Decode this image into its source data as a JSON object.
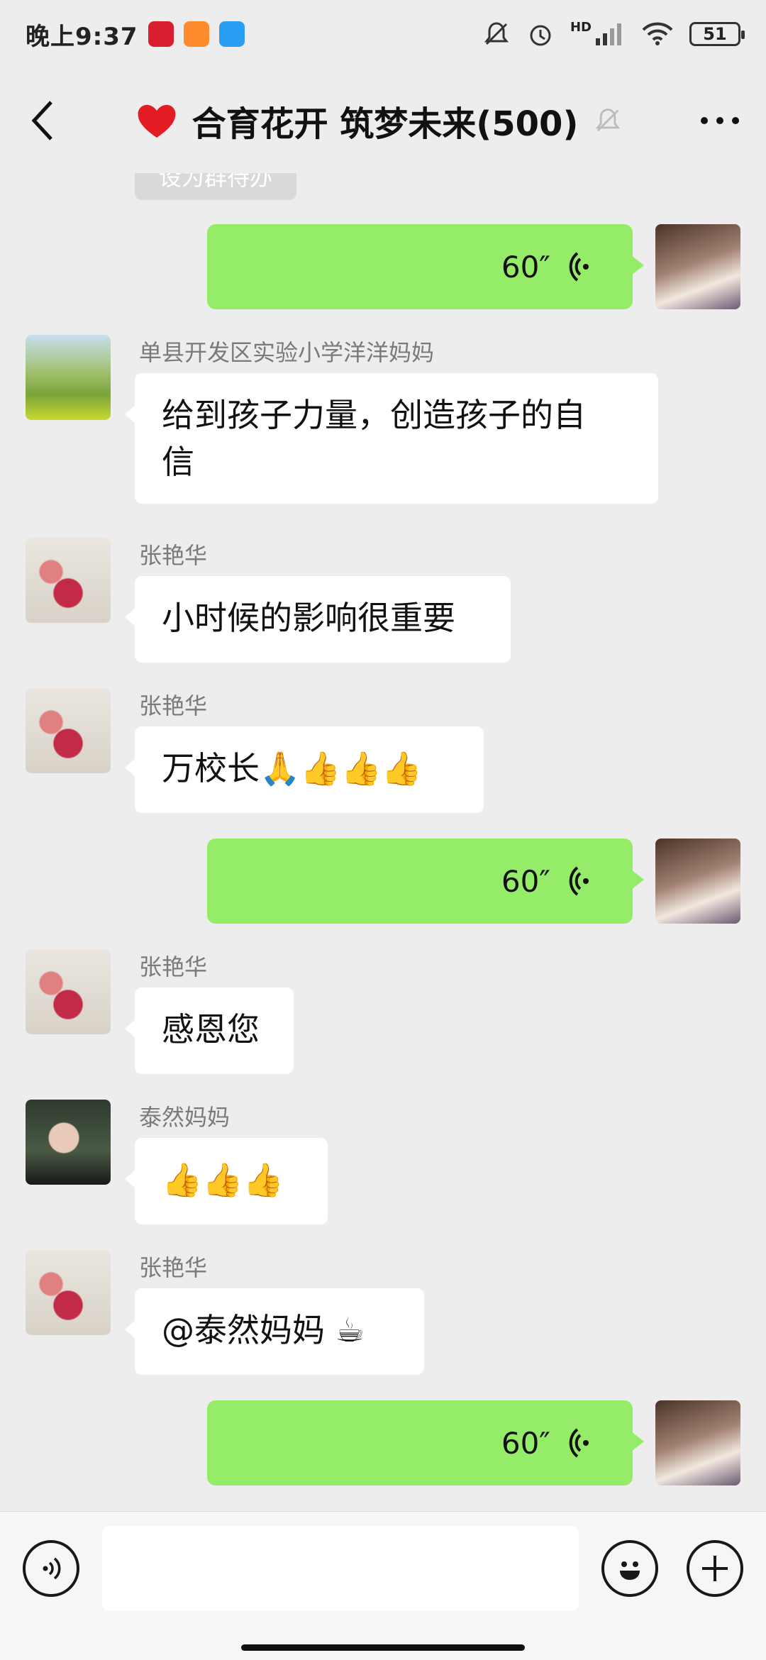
{
  "status": {
    "time": "晚上9:37",
    "battery": "51",
    "network": "HD"
  },
  "header": {
    "title": "合育花开 筑梦未来(500)",
    "emoji": "heart-emoji"
  },
  "system_tag": "设为群待办",
  "messages": [
    {
      "type": "voice",
      "side": "right",
      "duration": "60″"
    },
    {
      "type": "text",
      "side": "left",
      "sender": "单县开发区实验小学洋洋妈妈",
      "lines": [
        "给到孩子力量，创造孩子的自",
        "信"
      ]
    },
    {
      "type": "text",
      "side": "left",
      "sender": "张艳华",
      "text": "小时候的影响很重要"
    },
    {
      "type": "text",
      "side": "left",
      "sender": "张艳华",
      "text": "万校长",
      "emojis": [
        "🙏",
        "👍",
        "👍",
        "👍"
      ]
    },
    {
      "type": "voice",
      "side": "right",
      "duration": "60″"
    },
    {
      "type": "text",
      "side": "left",
      "sender": "张艳华",
      "text": "感恩您"
    },
    {
      "type": "text",
      "side": "left",
      "sender": "泰然妈妈",
      "emojis": [
        "👍",
        "👍",
        "👍"
      ]
    },
    {
      "type": "text",
      "side": "left",
      "sender": "张艳华",
      "text": "@泰然妈妈",
      "emojis": [
        "☕"
      ]
    },
    {
      "type": "voice",
      "side": "right",
      "duration": "60″"
    }
  ],
  "input": {
    "placeholder": ""
  },
  "colors": {
    "outgoing": "#95ec69",
    "incoming": "#ffffff",
    "background": "#ededed"
  }
}
